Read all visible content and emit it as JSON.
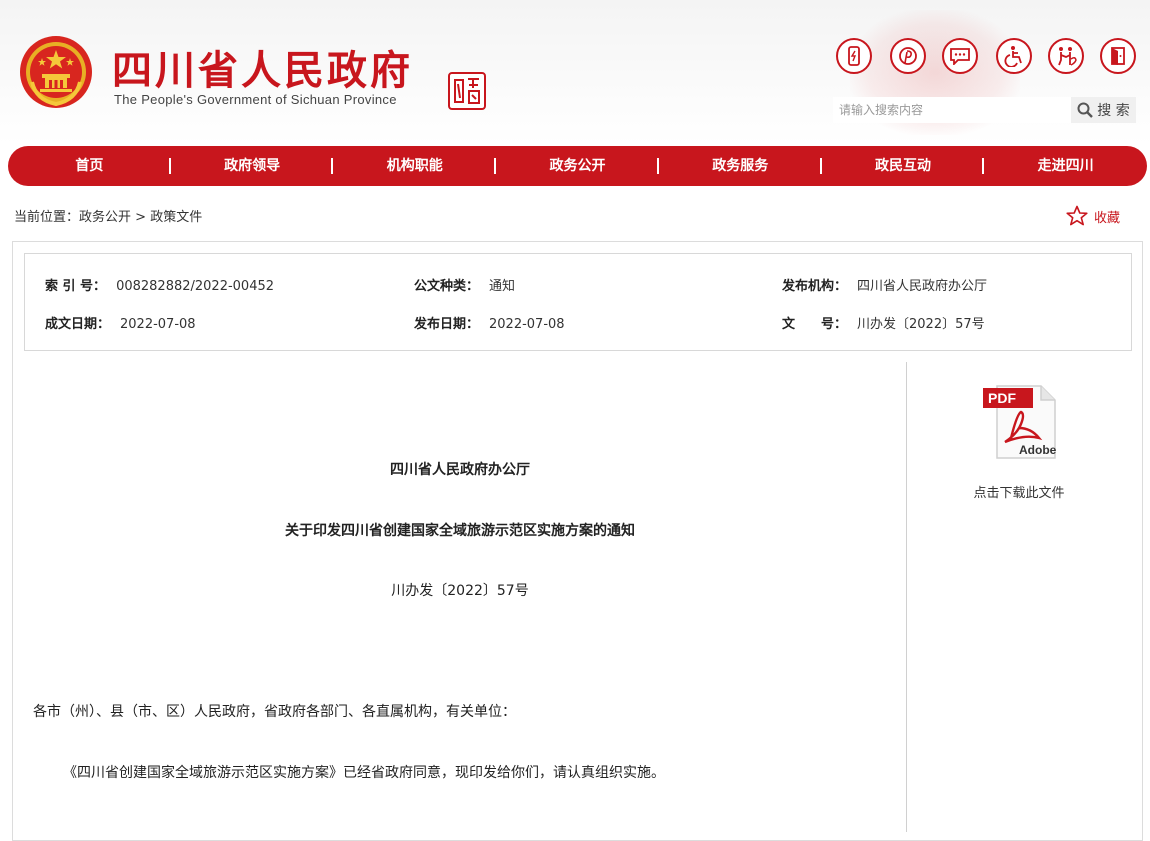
{
  "header": {
    "site_title": "四川省人民政府",
    "site_subtitle": "The People's Government of Sichuan Province",
    "seal_text": "中国四川",
    "colors": {
      "brand_red": "#c8161d",
      "nav_red": "#c8161d"
    },
    "tool_icons": [
      "mobile-icon",
      "weibo-pinterest-icon",
      "message-icon",
      "accessibility-icon",
      "care-mode-icon",
      "exit-icon"
    ]
  },
  "search": {
    "placeholder": "请输入搜索内容",
    "button_label": "搜 索"
  },
  "nav": {
    "items": [
      "首页",
      "政府领导",
      "机构职能",
      "政务公开",
      "政务服务",
      "政民互动",
      "走进四川"
    ]
  },
  "breadcrumb": {
    "prefix": "当前位置：",
    "items": [
      "政务公开",
      "政策文件"
    ],
    "separator": " > "
  },
  "favorite_label": "收藏",
  "meta": {
    "index_no": {
      "label": "索 引 号：",
      "value": "008282882/2022-00452"
    },
    "doc_type": {
      "label": "公文种类：",
      "value": "通知"
    },
    "issuer": {
      "label": "发布机构：",
      "value": "四川省人民政府办公厅"
    },
    "written_date": {
      "label": "成文日期：",
      "value": "2022-07-08"
    },
    "publish_date": {
      "label": "发布日期：",
      "value": "2022-07-08"
    },
    "doc_no": {
      "label": "文　　号：",
      "value": "川办发〔2022〕57号"
    }
  },
  "document": {
    "issuer_heading": "四川省人民政府办公厅",
    "title": "关于印发四川省创建国家全域旅游示范区实施方案的通知",
    "doc_number": "川办发〔2022〕57号",
    "recipients": "各市（州）、县（市、区）人民政府，省政府各部门、各直属机构，有关单位：",
    "body_line_1": "《四川省创建国家全域旅游示范区实施方案》已经省政府同意，现印发给你们，请认真组织实施。"
  },
  "download": {
    "pdf_badge": "PDF",
    "adobe_text": "Adobe",
    "label": "点击下载此文件"
  }
}
